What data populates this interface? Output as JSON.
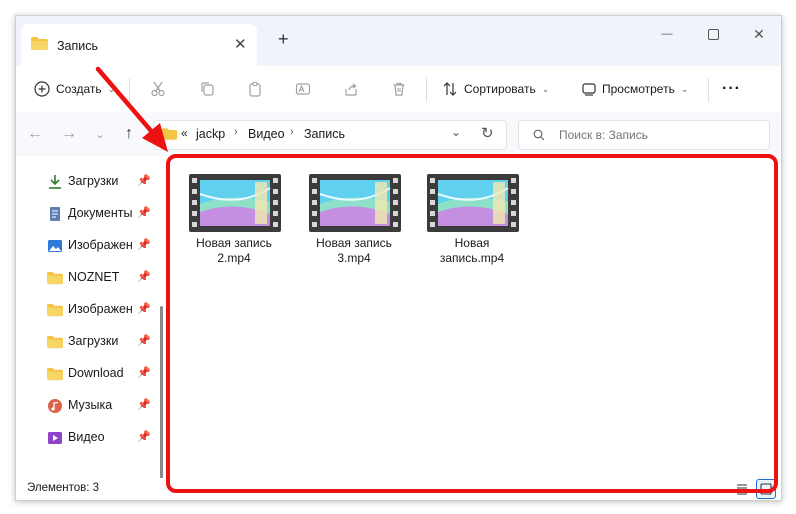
{
  "tab": {
    "title": "Запись",
    "close_glyph": "✕"
  },
  "window": {
    "new_tab_glyph": "+",
    "minimize_glyph": "—",
    "maximize_glyph": "☐",
    "close_glyph": "✕"
  },
  "toolbar": {
    "create_label": "Создать",
    "sort_label": "Сортировать",
    "view_label": "Просмотреть",
    "more_label": "···"
  },
  "address": {
    "overflow": "«",
    "crumbs": [
      "jackp",
      "Видео",
      "Запись"
    ]
  },
  "search": {
    "placeholder": "Поиск в: Запись"
  },
  "sidebar": {
    "items": [
      {
        "label": "Загрузки",
        "icon": "download-icon"
      },
      {
        "label": "Документы",
        "icon": "documents-icon"
      },
      {
        "label": "Изображения",
        "icon": "pictures-icon"
      },
      {
        "label": "NOZNET",
        "icon": "folder-icon"
      },
      {
        "label": "Изображения",
        "icon": "folder-icon"
      },
      {
        "label": "Загрузки",
        "icon": "folder-icon"
      },
      {
        "label": "Download",
        "icon": "folder-icon"
      },
      {
        "label": "Музыка",
        "icon": "music-icon"
      },
      {
        "label": "Видео",
        "icon": "video-icon"
      }
    ]
  },
  "files": [
    {
      "line1": "Новая запись",
      "line2": "2.mp4"
    },
    {
      "line1": "Новая запись",
      "line2": "3.mp4"
    },
    {
      "line1": "Новая",
      "line2": "запись.mp4"
    }
  ],
  "status": {
    "count": "Элементов: 3"
  },
  "colors": {
    "annotation": "#ee1111",
    "folder": "#f4c542",
    "accent": "#1a6fd6"
  }
}
